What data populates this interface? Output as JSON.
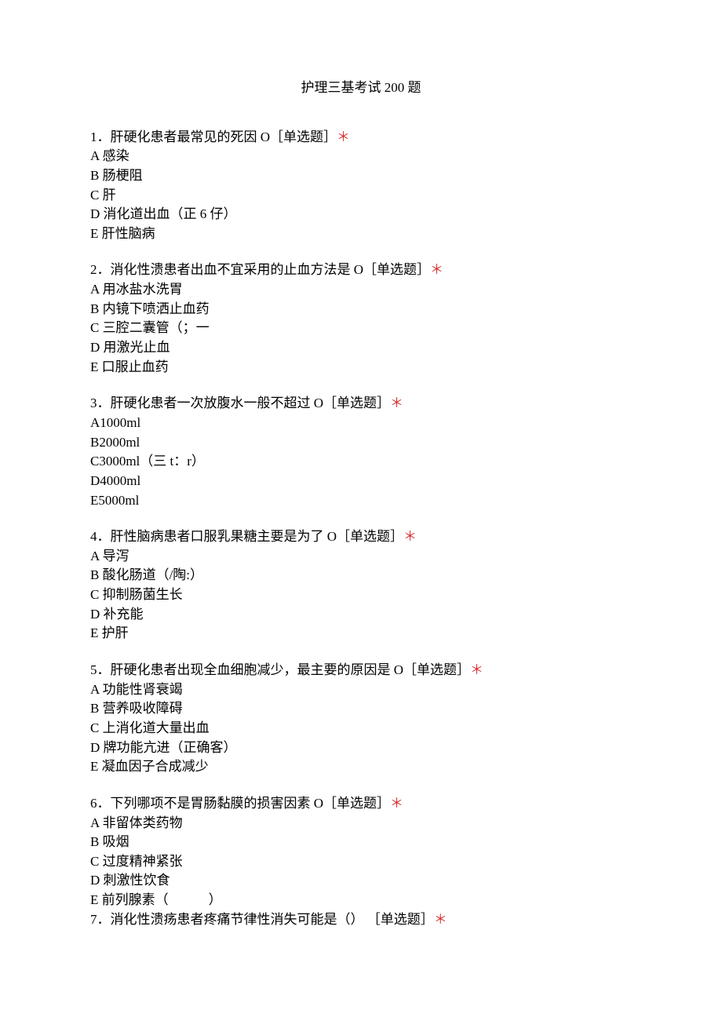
{
  "title": "护理三基考试 200 题",
  "questions": [
    {
      "num": "1",
      "stem": "．肝硬化患者最常见的死因 O［单选题］",
      "options": [
        "A 感染",
        "B 肠梗阻",
        "C 肝",
        "D 消化道出血（正 6 仔）",
        "E 肝性脑病"
      ]
    },
    {
      "num": "2",
      "stem": "．消化性溃患者出血不宜采用的止血方法是 O［单选题］",
      "options": [
        "A 用冰盐水洗胃",
        "B 内镜下喷洒止血药",
        "C 三腔二囊管（；一",
        "D 用激光止血",
        "E 口服止血药"
      ]
    },
    {
      "num": "3",
      "stem": "．肝硬化患者一次放腹水一般不超过 O［单选题］",
      "options": [
        "A1000ml",
        "B2000ml",
        "C3000ml（三 t：r）",
        "D4000ml",
        "E5000ml"
      ]
    },
    {
      "num": "4",
      "stem": "．肝性脑病患者口服乳果糖主要是为了 O［单选题］",
      "options": [
        "A 导泻",
        "B 酸化肠道（/陶:）",
        "C 抑制肠菌生长",
        "D 补充能",
        "E 护肝"
      ]
    },
    {
      "num": "5",
      "stem": "．肝硬化患者出现全血细胞减少，最主要的原因是 O［单选题］",
      "options": [
        "A 功能性肾衰竭",
        "B 营养吸收障碍",
        "C 上消化道大量出血",
        "D 牌功能亢进（正确客）",
        "E 凝血因子合成减少"
      ]
    },
    {
      "num": "6",
      "stem": "．下列哪项不是胃肠黏膜的损害因素 O［单选题］",
      "options": [
        "A 非留体类药物",
        "B 吸烟",
        "C 过度精神紧张",
        "D 刺激性饮食",
        "E 前列腺素（　　　）"
      ]
    },
    {
      "num": "7",
      "stem": "．消化性溃疡患者疼痛节律性消失可能是（） ［单选题］",
      "options": []
    }
  ],
  "asterisk": "＊"
}
